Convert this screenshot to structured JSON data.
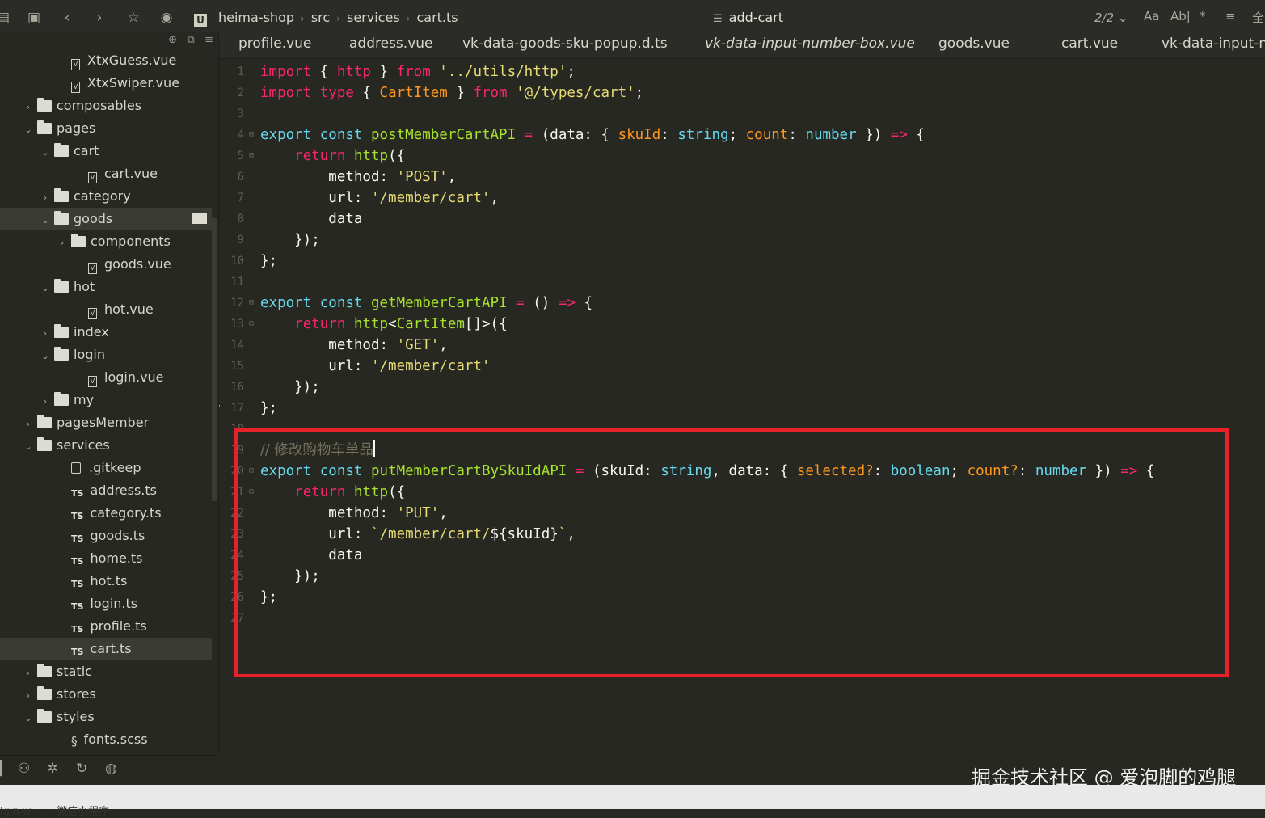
{
  "topbar": {
    "breadcrumb": [
      "heima-shop",
      "src",
      "services",
      "cart.ts"
    ],
    "search_term": "add-cart",
    "match_count": "2/2",
    "right_icons": [
      "Aa",
      "Ab|",
      "*",
      "≡",
      "全"
    ]
  },
  "tabs": [
    {
      "label": "profile.vue",
      "italic": false
    },
    {
      "label": "address.vue",
      "italic": false
    },
    {
      "label": "vk-data-goods-sku-popup.d.ts",
      "italic": false
    },
    {
      "label": "vk-data-input-number-box.vue",
      "italic": true
    },
    {
      "label": "goods.vue",
      "italic": false
    },
    {
      "label": "cart.vue",
      "italic": false
    },
    {
      "label": "vk-data-input-n",
      "italic": false
    }
  ],
  "sidebar": {
    "items": [
      {
        "label": "XtxGuess.vue",
        "type": "vue",
        "depth": 3,
        "caret": ""
      },
      {
        "label": "XtxSwiper.vue",
        "type": "vue",
        "depth": 3,
        "caret": ""
      },
      {
        "label": "composables",
        "type": "folder",
        "depth": 1,
        "caret": "›"
      },
      {
        "label": "pages",
        "type": "folder-open",
        "depth": 1,
        "caret": "⌄"
      },
      {
        "label": "cart",
        "type": "folder-open",
        "depth": 2,
        "caret": "⌄"
      },
      {
        "label": "cart.vue",
        "type": "vue",
        "depth": 4,
        "caret": ""
      },
      {
        "label": "category",
        "type": "folder",
        "depth": 2,
        "caret": "›"
      },
      {
        "label": "goods",
        "type": "folder-open",
        "depth": 2,
        "caret": "⌄",
        "selected": true
      },
      {
        "label": "components",
        "type": "folder",
        "depth": 3,
        "caret": "›"
      },
      {
        "label": "goods.vue",
        "type": "vue",
        "depth": 4,
        "caret": ""
      },
      {
        "label": "hot",
        "type": "folder-open",
        "depth": 2,
        "caret": "⌄"
      },
      {
        "label": "hot.vue",
        "type": "vue",
        "depth": 4,
        "caret": ""
      },
      {
        "label": "index",
        "type": "folder",
        "depth": 2,
        "caret": "›"
      },
      {
        "label": "login",
        "type": "folder-open",
        "depth": 2,
        "caret": "⌄"
      },
      {
        "label": "login.vue",
        "type": "vue",
        "depth": 4,
        "caret": ""
      },
      {
        "label": "my",
        "type": "folder",
        "depth": 2,
        "caret": "›"
      },
      {
        "label": "pagesMember",
        "type": "folder",
        "depth": 1,
        "caret": "›"
      },
      {
        "label": "services",
        "type": "folder-open",
        "depth": 1,
        "caret": "⌄"
      },
      {
        "label": ".gitkeep",
        "type": "file",
        "depth": 3,
        "caret": ""
      },
      {
        "label": "address.ts",
        "type": "ts",
        "depth": 3,
        "caret": ""
      },
      {
        "label": "category.ts",
        "type": "ts",
        "depth": 3,
        "caret": ""
      },
      {
        "label": "goods.ts",
        "type": "ts",
        "depth": 3,
        "caret": ""
      },
      {
        "label": "home.ts",
        "type": "ts",
        "depth": 3,
        "caret": ""
      },
      {
        "label": "hot.ts",
        "type": "ts",
        "depth": 3,
        "caret": ""
      },
      {
        "label": "login.ts",
        "type": "ts",
        "depth": 3,
        "caret": ""
      },
      {
        "label": "profile.ts",
        "type": "ts",
        "depth": 3,
        "caret": ""
      },
      {
        "label": "cart.ts",
        "type": "ts",
        "depth": 3,
        "caret": "",
        "selected": true
      },
      {
        "label": "static",
        "type": "folder",
        "depth": 1,
        "caret": "›"
      },
      {
        "label": "stores",
        "type": "folder",
        "depth": 1,
        "caret": "›"
      },
      {
        "label": "styles",
        "type": "folder-open",
        "depth": 1,
        "caret": "⌄"
      },
      {
        "label": "fonts.scss",
        "type": "scss",
        "depth": 3,
        "caret": ""
      }
    ]
  },
  "editor": {
    "lines": [
      {
        "n": "1",
        "fold": "",
        "tokens": [
          [
            "kw2",
            "import"
          ],
          [
            "pl",
            " { "
          ],
          [
            "kw2",
            "http"
          ],
          [
            "pl",
            " } "
          ],
          [
            "kw2",
            "from"
          ],
          [
            "pl",
            " "
          ],
          [
            "str",
            "'../utils/http'"
          ],
          [
            "pl",
            ";"
          ]
        ]
      },
      {
        "n": "2",
        "fold": "",
        "tokens": [
          [
            "kw2",
            "import"
          ],
          [
            "pl",
            " "
          ],
          [
            "kw2",
            "type"
          ],
          [
            "pl",
            " { "
          ],
          [
            "param",
            "CartItem"
          ],
          [
            "pl",
            " } "
          ],
          [
            "kw2",
            "from"
          ],
          [
            "pl",
            " "
          ],
          [
            "str",
            "'@/types/cart'"
          ],
          [
            "pl",
            ";"
          ]
        ]
      },
      {
        "n": "3",
        "fold": "",
        "tokens": []
      },
      {
        "n": "4",
        "fold": "⊟",
        "tokens": [
          [
            "kw",
            "export"
          ],
          [
            "pl",
            " "
          ],
          [
            "kw",
            "const"
          ],
          [
            "pl",
            " "
          ],
          [
            "fn",
            "postMemberCartAPI"
          ],
          [
            "pl",
            " "
          ],
          [
            "op",
            "="
          ],
          [
            "pl",
            " (data: { "
          ],
          [
            "param",
            "skuId"
          ],
          [
            "pl",
            ": "
          ],
          [
            "typ",
            "string"
          ],
          [
            "pl",
            "; "
          ],
          [
            "param",
            "count"
          ],
          [
            "pl",
            ": "
          ],
          [
            "typ",
            "number"
          ],
          [
            "pl",
            " }) "
          ],
          [
            "op",
            "=>"
          ],
          [
            "pl",
            " {"
          ]
        ]
      },
      {
        "n": "5",
        "fold": "⊟",
        "tokens": [
          [
            "pl",
            "    "
          ],
          [
            "kw2",
            "return"
          ],
          [
            "pl",
            " "
          ],
          [
            "fn",
            "http"
          ],
          [
            "pl",
            "({"
          ]
        ]
      },
      {
        "n": "6",
        "fold": "",
        "tokens": [
          [
            "pl",
            "        method: "
          ],
          [
            "str",
            "'POST'"
          ],
          [
            "pl",
            ","
          ]
        ]
      },
      {
        "n": "7",
        "fold": "",
        "tokens": [
          [
            "pl",
            "        url: "
          ],
          [
            "str",
            "'/member/cart'"
          ],
          [
            "pl",
            ","
          ]
        ]
      },
      {
        "n": "8",
        "fold": "",
        "tokens": [
          [
            "pl",
            "        data"
          ]
        ]
      },
      {
        "n": "9",
        "fold": "",
        "tokens": [
          [
            "pl",
            "    });"
          ]
        ]
      },
      {
        "n": "10",
        "fold": "",
        "tokens": [
          [
            "pl",
            "};"
          ]
        ]
      },
      {
        "n": "11",
        "fold": "",
        "tokens": []
      },
      {
        "n": "12",
        "fold": "⊟",
        "tokens": [
          [
            "kw",
            "export"
          ],
          [
            "pl",
            " "
          ],
          [
            "kw",
            "const"
          ],
          [
            "pl",
            " "
          ],
          [
            "fn",
            "getMemberCartAPI"
          ],
          [
            "pl",
            " "
          ],
          [
            "op",
            "="
          ],
          [
            "pl",
            " () "
          ],
          [
            "op",
            "=>"
          ],
          [
            "pl",
            " {"
          ]
        ]
      },
      {
        "n": "13",
        "fold": "⊟",
        "tokens": [
          [
            "pl",
            "    "
          ],
          [
            "kw2",
            "return"
          ],
          [
            "pl",
            " "
          ],
          [
            "fn",
            "http"
          ],
          [
            "pl",
            "<"
          ],
          [
            "fn",
            "CartItem"
          ],
          [
            "pl",
            "[]>({"
          ]
        ]
      },
      {
        "n": "14",
        "fold": "",
        "tokens": [
          [
            "pl",
            "        method: "
          ],
          [
            "str",
            "'GET'"
          ],
          [
            "pl",
            ","
          ]
        ]
      },
      {
        "n": "15",
        "fold": "",
        "tokens": [
          [
            "pl",
            "        url: "
          ],
          [
            "str",
            "'/member/cart'"
          ]
        ]
      },
      {
        "n": "16",
        "fold": "",
        "tokens": [
          [
            "pl",
            "    });"
          ]
        ]
      },
      {
        "n": "17",
        "fold": "",
        "tokens": [
          [
            "pl",
            "};"
          ]
        ]
      },
      {
        "n": "18",
        "fold": "",
        "tokens": []
      },
      {
        "n": "19",
        "fold": "",
        "tokens": [
          [
            "cm",
            "// 修改购物车单品"
          ]
        ],
        "cursor": true
      },
      {
        "n": "20",
        "fold": "⊟",
        "tokens": [
          [
            "kw",
            "export"
          ],
          [
            "pl",
            " "
          ],
          [
            "kw",
            "const"
          ],
          [
            "pl",
            " "
          ],
          [
            "fn",
            "putMemberCartBySkuIdAPI"
          ],
          [
            "pl",
            " "
          ],
          [
            "op",
            "="
          ],
          [
            "pl",
            " (skuId: "
          ],
          [
            "typ",
            "string"
          ],
          [
            "pl",
            ", data: { "
          ],
          [
            "param",
            "selected?"
          ],
          [
            "pl",
            ": "
          ],
          [
            "typ",
            "boolean"
          ],
          [
            "pl",
            "; "
          ],
          [
            "param",
            "count?"
          ],
          [
            "pl",
            ": "
          ],
          [
            "typ",
            "number"
          ],
          [
            "pl",
            " }) "
          ],
          [
            "op",
            "=>"
          ],
          [
            "pl",
            " {"
          ]
        ]
      },
      {
        "n": "21",
        "fold": "⊟",
        "tokens": [
          [
            "pl",
            "    "
          ],
          [
            "kw2",
            "return"
          ],
          [
            "pl",
            " "
          ],
          [
            "fn",
            "http"
          ],
          [
            "pl",
            "({"
          ]
        ]
      },
      {
        "n": "22",
        "fold": "",
        "tokens": [
          [
            "pl",
            "        method: "
          ],
          [
            "str",
            "'PUT'"
          ],
          [
            "pl",
            ","
          ]
        ]
      },
      {
        "n": "23",
        "fold": "",
        "tokens": [
          [
            "pl",
            "        url: "
          ],
          [
            "str",
            "`/member/cart/"
          ],
          [
            "pl",
            "${skuId}"
          ],
          [
            "str",
            "`"
          ],
          [
            "pl",
            ","
          ]
        ]
      },
      {
        "n": "24",
        "fold": "",
        "tokens": [
          [
            "pl",
            "        data"
          ]
        ]
      },
      {
        "n": "25",
        "fold": "",
        "tokens": [
          [
            "pl",
            "    });"
          ]
        ]
      },
      {
        "n": "26",
        "fold": "",
        "tokens": [
          [
            "pl",
            "};"
          ]
        ]
      },
      {
        "n": "27",
        "fold": "",
        "tokens": []
      }
    ]
  },
  "watermark": "掘金技术社区 @ 爱泡脚的鸡腿",
  "statusbar": {
    "left": "lgin     w  ~ ··   微信小程序"
  },
  "colors": {
    "background": "#272822",
    "keyword": "#66d9ef",
    "keyword_pink": "#f92672",
    "function": "#a6e22e",
    "string": "#e6db74",
    "param": "#fd971f",
    "highlight_box": "#e8202a"
  }
}
